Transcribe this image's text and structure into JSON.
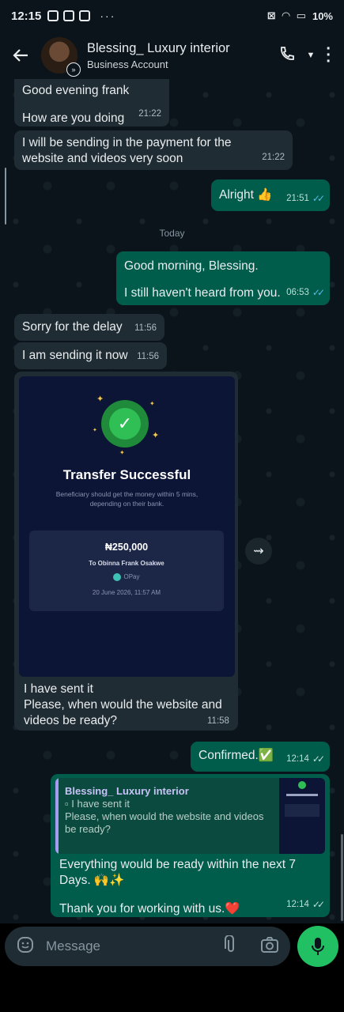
{
  "status": {
    "time": "12:15",
    "dots": "···",
    "battery": "10%"
  },
  "header": {
    "name": "Blessing_ Luxury interior",
    "subtitle": "Business Account"
  },
  "messages": [
    {
      "line1": "Good evening frank",
      "line2": "How are you doing",
      "time": "21:22"
    },
    {
      "text": "I will be sending in the payment for the website and videos very soon",
      "time": "21:22"
    },
    {
      "text": "Alright 👍",
      "time": "21:51"
    },
    {
      "line1": "Good morning, Blessing.",
      "line2": "I still haven't heard from you.",
      "time": "06:53"
    },
    {
      "text": "Sorry for the delay",
      "time": "11:56"
    },
    {
      "text": "I am sending it now",
      "time": "11:56"
    },
    {
      "line1": "I have sent it",
      "line2": "Please, when would the website and videos be ready?",
      "time": "11:58"
    },
    {
      "text": "Confirmed.✅",
      "time": "12:14"
    },
    {
      "line1": "Everything would be ready within the next 7 Days. 🙌✨",
      "line2": "Thank you for working with us.❤️",
      "time": "12:14"
    }
  ],
  "day_chip": "Today",
  "receipt": {
    "title": "Transfer Successful",
    "subtitle": "Beneficiary should get the money within 5 mins, depending on their bank.",
    "amount": "₦250,000",
    "recipient": "To Obinna Frank Osakwe",
    "bank": "OPay",
    "date": "20 June 2026, 11:57 AM"
  },
  "quote": {
    "name": "Blessing_ Luxury interior",
    "line1": "I have sent it",
    "line2": "Please, when would the website and videos be ready?"
  },
  "composer": {
    "placeholder": "Message"
  }
}
